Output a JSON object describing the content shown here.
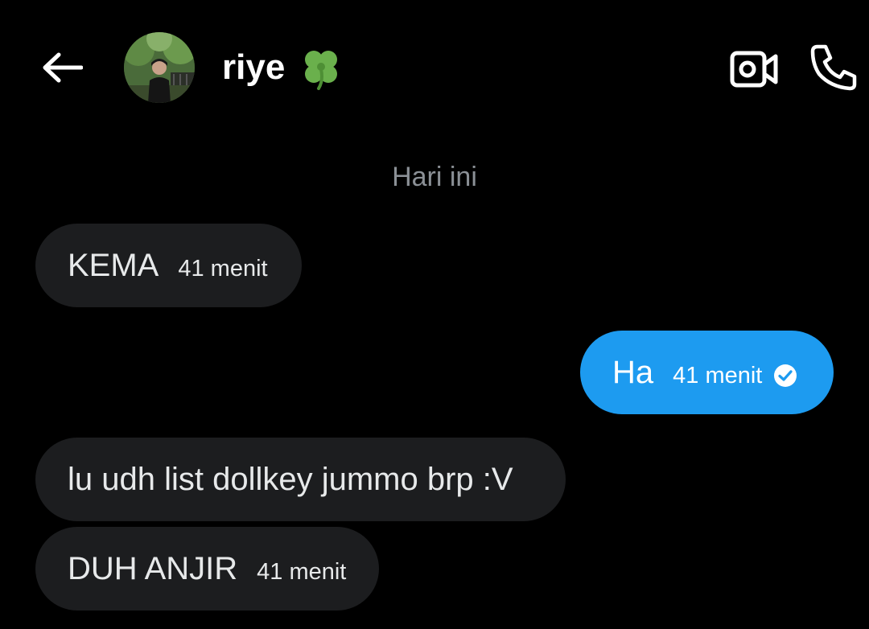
{
  "header": {
    "contact_name": "riye",
    "contact_emoji_icon": "four-leaf-clover-icon",
    "back_icon": "arrow-left-icon",
    "video_icon": "video-call-icon",
    "call_icon": "phone-icon"
  },
  "conversation": {
    "date_divider": "Hari ini",
    "messages": [
      {
        "direction": "incoming",
        "text": "KEMA",
        "time": "41 menit"
      },
      {
        "direction": "outgoing",
        "text": "Ha",
        "time": "41 menit",
        "status_icon": "read-check-icon"
      },
      {
        "direction": "incoming",
        "text": "lu udh list dollkey jummo brp :V",
        "time": ""
      },
      {
        "direction": "incoming",
        "text": "DUH ANJIR",
        "time": "41 menit"
      }
    ]
  },
  "colors": {
    "background": "#000000",
    "incoming_bubble": "#1c1d1f",
    "outgoing_bubble": "#1d9bf0",
    "muted_text": "#8b9096",
    "primary_text": "#e7e9ea"
  }
}
